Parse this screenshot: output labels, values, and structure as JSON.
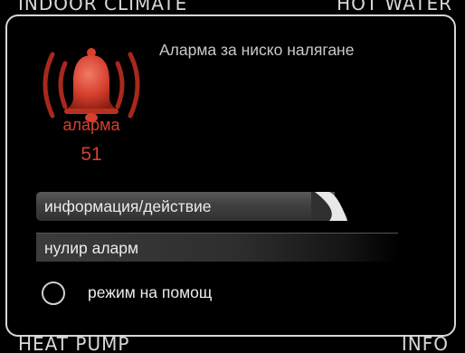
{
  "background_screen": {
    "top_left_label": "INDOOR CLIMATE",
    "top_right_label": "HOT WATER",
    "bottom_left_label": "HEAT PUMP",
    "bottom_right_label": "INFO"
  },
  "dialog": {
    "title": "Аларма за ниско налягане",
    "alarm": {
      "icon": "alarm-bell-icon",
      "label": "аларма",
      "code": "51"
    },
    "menu": {
      "items": [
        {
          "label": "информация/действие",
          "selected": true
        },
        {
          "label": "нулир аларм",
          "selected": false
        }
      ]
    },
    "option": {
      "label": "режим на помощ",
      "checked": false
    }
  },
  "colors": {
    "background": "#000000",
    "accent_red": "#d6402e",
    "text": "#ececec",
    "border": "#d6d6d6"
  }
}
